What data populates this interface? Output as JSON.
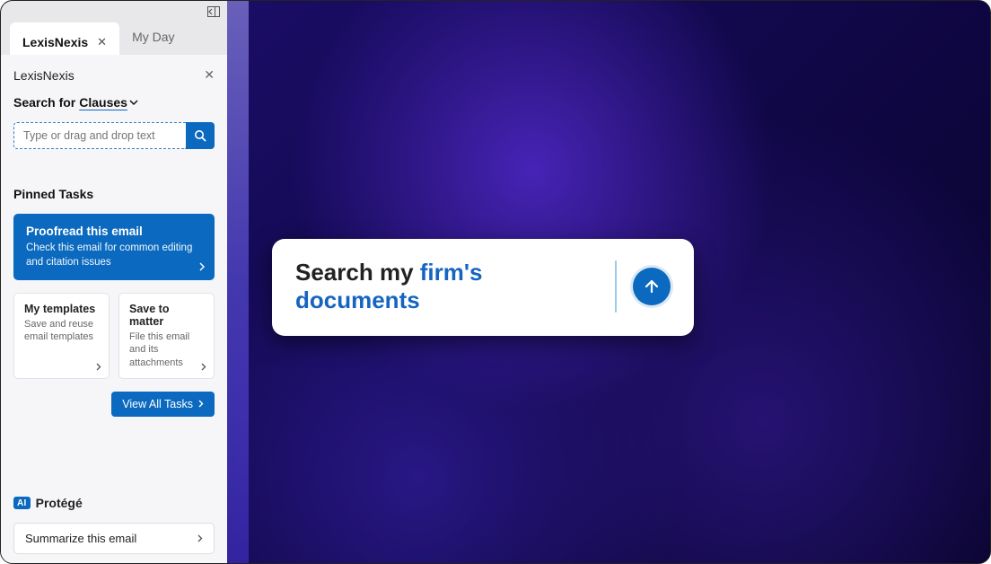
{
  "tabs": {
    "active": "LexisNexis",
    "inactive": "My Day"
  },
  "pane": {
    "title": "LexisNexis",
    "search_for_prefix": "Search for",
    "search_for_dropdown": "Clauses",
    "search_placeholder": "Type or drag and drop text",
    "pinned_section": "Pinned Tasks",
    "primary_task": {
      "title": "Proofread this email",
      "desc": "Check this email for common editing and citation issues"
    },
    "tasks": [
      {
        "title": "My templates",
        "desc": "Save and reuse email templates"
      },
      {
        "title": "Save to matter",
        "desc": "File this email and its attachments"
      }
    ],
    "view_all": "View All Tasks",
    "protege_badge": "AI",
    "protege_label": "Protégé",
    "quick_action": "Summarize this email"
  },
  "hero": {
    "prefix": "Search my ",
    "highlight": "firm's documents"
  },
  "colors": {
    "primary": "#0b6abf"
  }
}
